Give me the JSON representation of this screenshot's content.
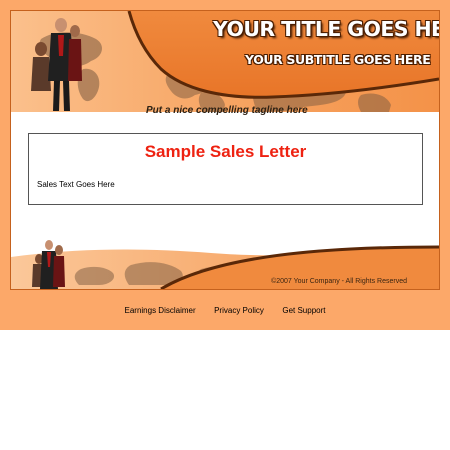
{
  "header": {
    "title": "YOUR TITLE GOES HERE",
    "subtitle": "YOUR SUBTITLE GOES HERE",
    "tagline": "Put a nice compelling tagline here"
  },
  "letter": {
    "title": "Sample Sales Letter",
    "text": "Sales Text Goes Here"
  },
  "footer": {
    "copyright": "©2007 Your Company - All Rights Reserved",
    "links": [
      "Earnings Disclaimer",
      "Privacy Policy",
      "Get Support"
    ]
  },
  "colors": {
    "page_orange": "#fca869",
    "banner_orange": "#f08a3e",
    "title_red": "#ee2211",
    "swoosh_brown": "#5a2808"
  }
}
